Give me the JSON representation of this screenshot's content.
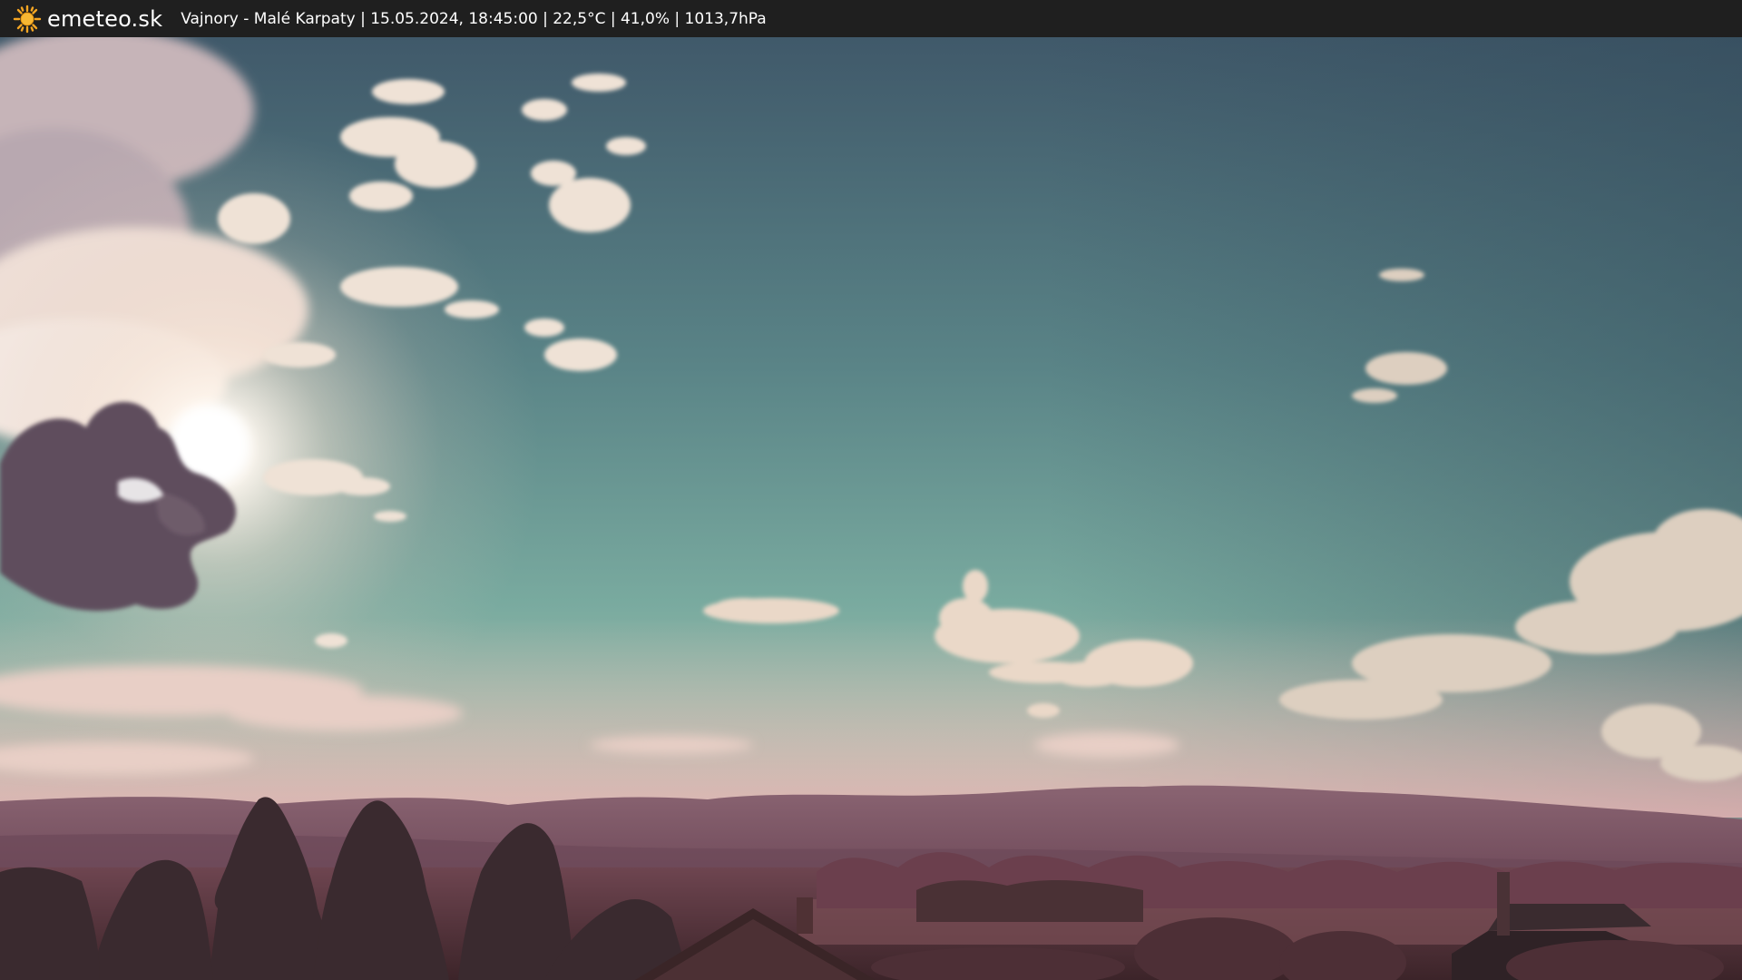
{
  "header": {
    "brand": "emeteo.sk",
    "logo_icon": "sun-icon",
    "caption": "Vajnory - Malé Karpaty | 15.05.2024, 18:45:00 | 22,5°C | 41,0% | 1013,7hPa"
  },
  "colors": {
    "topbar": "#1f1f1f",
    "sun_icon": "#f5a623",
    "sky_top": "#3f5a66",
    "sky_mid": "#6fa39a",
    "sky_horizon": "#d8c2b6",
    "hills": "#7a5363",
    "foreground": "#4a2d33"
  }
}
